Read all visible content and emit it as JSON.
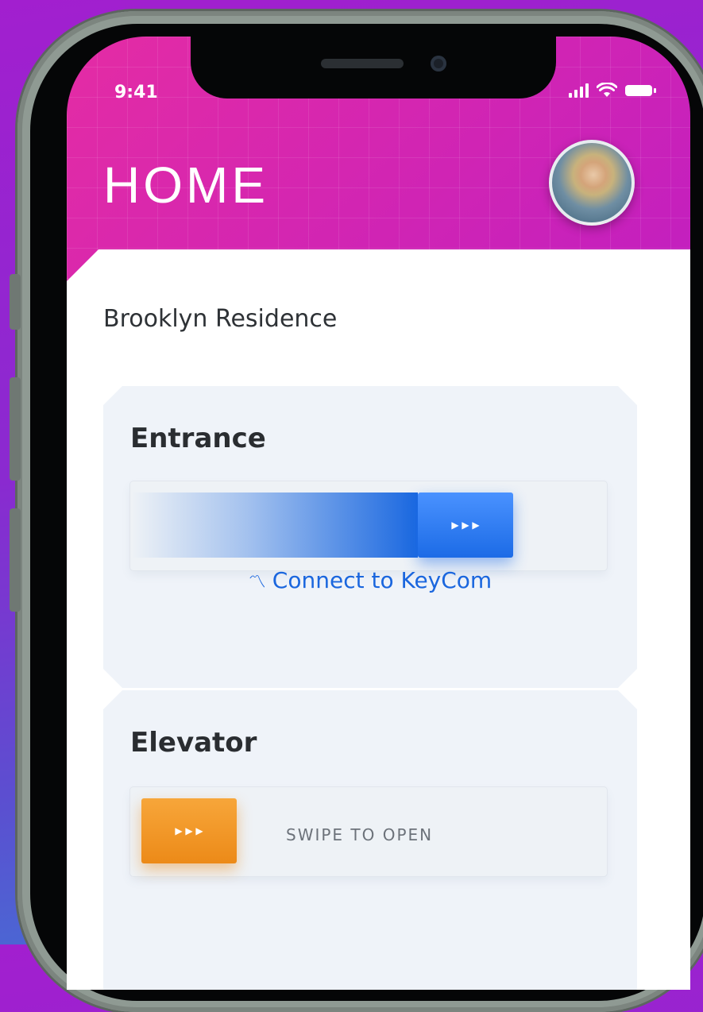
{
  "status_bar": {
    "time": "9:41",
    "signal_icon": "cellular-signal-icon",
    "wifi_icon": "wifi-icon",
    "battery_icon": "battery-icon"
  },
  "header": {
    "title": "HOME",
    "avatar_icon": "user-avatar"
  },
  "location": {
    "name": "Brooklyn Residence"
  },
  "doors": [
    {
      "title": "Entrance",
      "slider_progress_percent": 60,
      "accent_color": "#1a68e0",
      "handle_icon": "chevrons-right-icon",
      "action_icon": "wifi-signal-icon",
      "action_label": "Connect to KeyCom"
    },
    {
      "title": "Elevator",
      "slider_progress_percent": 0,
      "accent_color": "#ec8a18",
      "handle_icon": "chevrons-right-icon",
      "swipe_label": "SWIPE TO OPEN"
    }
  ],
  "colors": {
    "header_gradient_start": "#e42ca4",
    "header_gradient_end": "#a81ccb",
    "card_background": "#eff3f9",
    "link_blue": "#1a66de"
  }
}
